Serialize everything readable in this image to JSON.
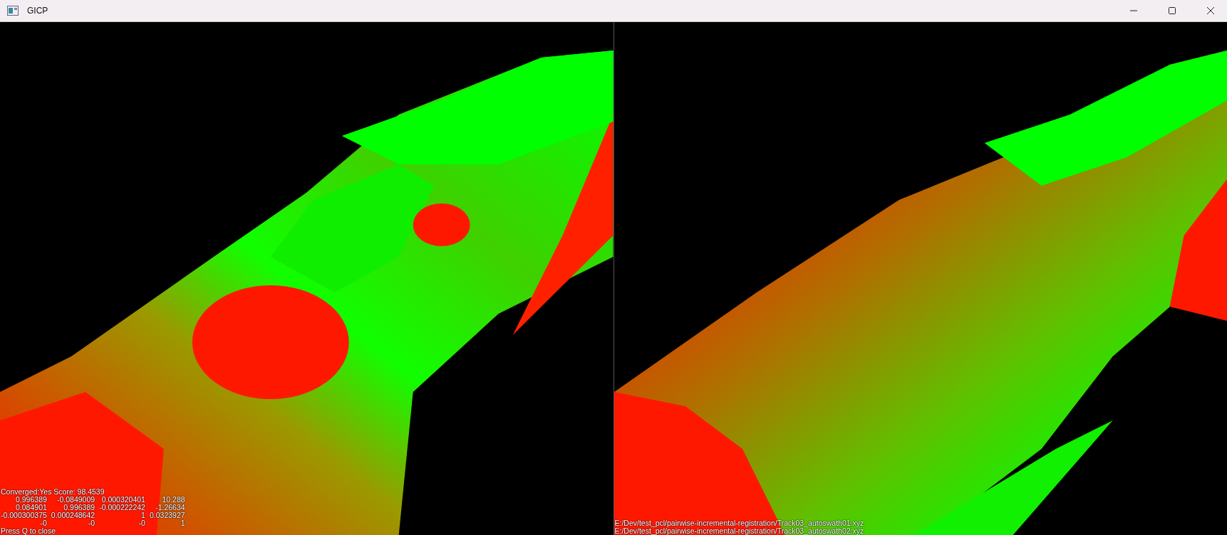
{
  "window": {
    "title": "GICP"
  },
  "left_view": {
    "status": "Converged:Yes Score: 98.4539",
    "matrix": [
      [
        "0.996389",
        "-0.0849009",
        "0.000320401",
        "10.288"
      ],
      [
        "0.084901",
        "0.996389",
        "-0.000222242",
        "-1.26634"
      ],
      [
        "-0.000300375",
        "0.000248642",
        "1",
        "0.0323927"
      ],
      [
        "-0",
        "-0",
        "-0",
        "1"
      ]
    ],
    "hint": "Press Q to close"
  },
  "right_view": {
    "files": [
      "E:/Dev/test_pcl/pairwise-incremental-registration/Track03_autoswath01.xyz",
      "E:/Dev/test_pcl/pairwise-incremental-registration/Track03_autoswath02.xyz"
    ]
  }
}
